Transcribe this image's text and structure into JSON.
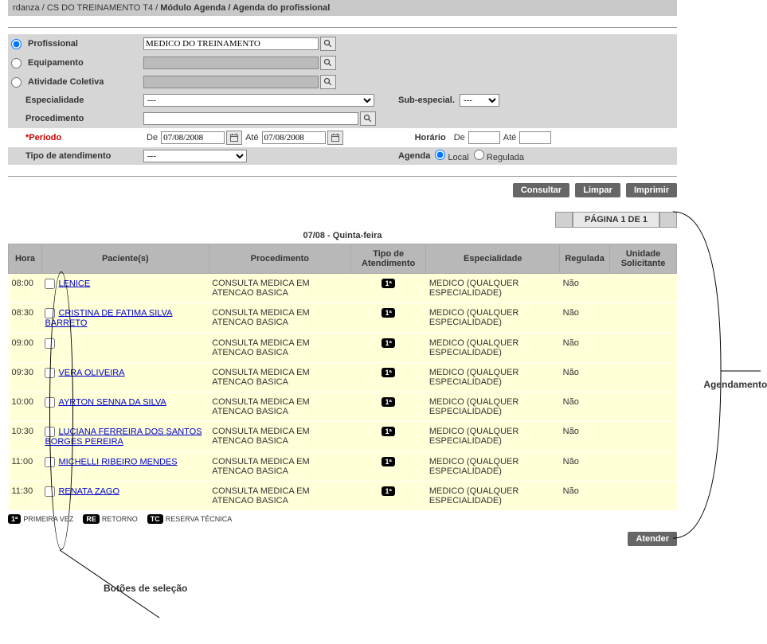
{
  "breadcrumb": {
    "p1": "rdanza",
    "p2": "CS DO TREINAMENTO T4",
    "p3": "Módulo Agenda",
    "p4": "Agenda do profissional"
  },
  "filters": {
    "profissional_label": "Profissional",
    "profissional_value": "MEDICO DO TREINAMENTO",
    "equipamento_label": "Equipamento",
    "equipamento_value": "",
    "atividade_label": "Atividade Coletiva",
    "atividade_value": "",
    "especialidade_label": "Especialidade",
    "especialidade_value": "---",
    "subespecial_label": "Sub-especial.",
    "subespecial_value": "---",
    "procedimento_label": "Procedimento",
    "procedimento_value": "",
    "periodo_label": "*Período",
    "periodo_de_label": "De",
    "periodo_de_value": "07/08/2008",
    "periodo_ate_label": "Até",
    "periodo_ate_value": "07/08/2008",
    "horario_label": "Horário",
    "horario_de_label": "De",
    "horario_de_value": "",
    "horario_ate_label": "Até",
    "horario_ate_value": "",
    "tipo_atend_label": "Tipo de atendimento",
    "tipo_atend_value": "---",
    "agenda_label": "Agenda",
    "agenda_local": "Local",
    "agenda_regulada": "Regulada"
  },
  "buttons": {
    "consultar": "Consultar",
    "limpar": "Limpar",
    "imprimir": "Imprimir",
    "atender": "Atender"
  },
  "pager": {
    "label": "PÁGINA 1 DE 1"
  },
  "table": {
    "title": "07/08 - Quinta-feira",
    "headers": {
      "hora": "Hora",
      "paciente": "Paciente(s)",
      "procedimento": "Procedimento",
      "tipo": "Tipo de Atendimento",
      "especialidade": "Especialidade",
      "regulada": "Regulada",
      "unidade": "Unidade Solicitante"
    },
    "rows": [
      {
        "hora": "08:00",
        "paciente": "LENICE",
        "proc": "CONSULTA MEDICA EM ATENCAO BASICA",
        "tipo": "1ª",
        "esp": "MEDICO (QUALQUER ESPECIALIDADE)",
        "reg": "Não",
        "uni": ""
      },
      {
        "hora": "08:30",
        "paciente": "CRISTINA DE FATIMA SILVA BARRETO",
        "proc": "CONSULTA MEDICA EM ATENCAO BASICA",
        "tipo": "1ª",
        "esp": "MEDICO (QUALQUER ESPECIALIDADE)",
        "reg": "Não",
        "uni": ""
      },
      {
        "hora": "09:00",
        "paciente": "",
        "proc": "CONSULTA MEDICA EM ATENCAO BASICA",
        "tipo": "1ª",
        "esp": "MEDICO (QUALQUER ESPECIALIDADE)",
        "reg": "Não",
        "uni": ""
      },
      {
        "hora": "09:30",
        "paciente": "VERA OLIVEIRA",
        "proc": "CONSULTA MEDICA EM ATENCAO BASICA",
        "tipo": "1ª",
        "esp": "MEDICO (QUALQUER ESPECIALIDADE)",
        "reg": "Não",
        "uni": ""
      },
      {
        "hora": "10:00",
        "paciente": "AYRTON SENNA DA SILVA",
        "proc": "CONSULTA MEDICA EM ATENCAO BASICA",
        "tipo": "1ª",
        "esp": "MEDICO (QUALQUER ESPECIALIDADE)",
        "reg": "Não",
        "uni": ""
      },
      {
        "hora": "10:30",
        "paciente": "LUCIANA FERREIRA DOS SANTOS BORGES PEREIRA",
        "proc": "CONSULTA MEDICA EM ATENCAO BASICA",
        "tipo": "1ª",
        "esp": "MEDICO (QUALQUER ESPECIALIDADE)",
        "reg": "Não",
        "uni": ""
      },
      {
        "hora": "11:00",
        "paciente": "MICHELLI RIBEIRO MENDES",
        "proc": "CONSULTA MEDICA EM ATENCAO BASICA",
        "tipo": "1ª",
        "esp": "MEDICO (QUALQUER ESPECIALIDADE)",
        "reg": "Não",
        "uni": ""
      },
      {
        "hora": "11:30",
        "paciente": "RENATA ZAGO",
        "proc": "CONSULTA MEDICA EM ATENCAO BASICA",
        "tipo": "1ª",
        "esp": "MEDICO (QUALQUER ESPECIALIDADE)",
        "reg": "Não",
        "uni": ""
      }
    ]
  },
  "legend": {
    "primeira_badge": "1ª",
    "primeira": "PRIMEIRA VEZ",
    "retorno_badge": "RE",
    "retorno": "RETORNO",
    "reserva_badge": "TC",
    "reserva": "RESERVA TÉCNICA"
  },
  "annotations": {
    "agendamentos": "Agendamentos",
    "botoes_selecao": "Botões de seleção"
  }
}
